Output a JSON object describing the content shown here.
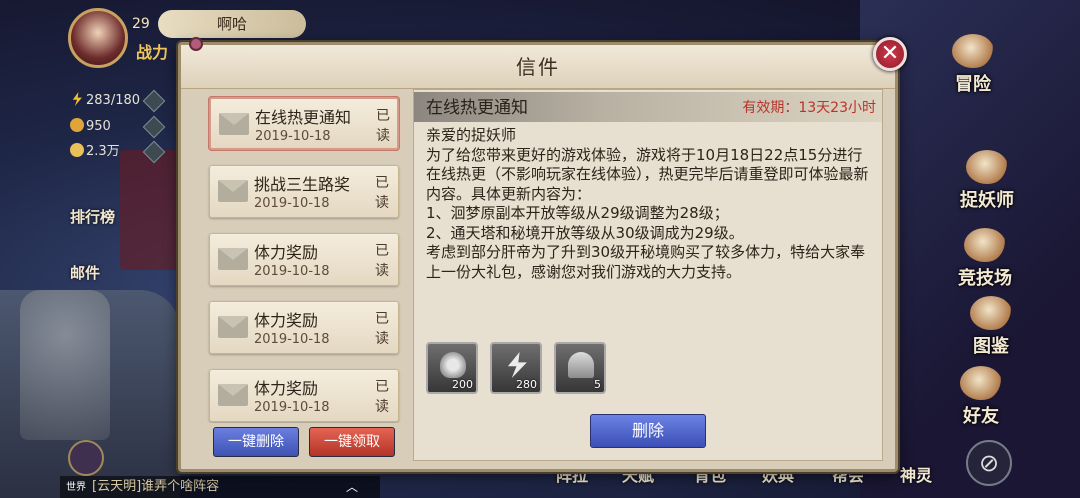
{
  "player": {
    "level": "29",
    "name": "啊哈",
    "power_label": "战力",
    "stamina": "283/180",
    "gold": "950",
    "coins": "2.3万"
  },
  "side_menu": [
    "排行榜",
    "邮件"
  ],
  "right_menu": [
    "冒险",
    "捉妖师",
    "竞技场",
    "图鉴",
    "好友"
  ],
  "bottom_menu": [
    "阵拉",
    "天赋",
    "背包",
    "妖典",
    "帮会",
    "神灵"
  ],
  "chat": {
    "tag": "世界",
    "text": "[云天明]谁弄个啥阵容"
  },
  "dialog": {
    "title": "信件",
    "close_symbol": "✕",
    "mails": [
      {
        "title": "在线热更通知",
        "date": "2019-10-18",
        "status": "已读"
      },
      {
        "title": "挑战三生路奖",
        "date": "2019-10-18",
        "status": "已读"
      },
      {
        "title": "体力奖励",
        "date": "2019-10-18",
        "status": "已读"
      },
      {
        "title": "体力奖励",
        "date": "2019-10-18",
        "status": "已读"
      },
      {
        "title": "体力奖励",
        "date": "2019-10-18",
        "status": "已读"
      }
    ],
    "batch_delete": "一键删除",
    "batch_collect": "一键领取",
    "content": {
      "subject": "在线热更通知",
      "validity": "有效期：13天23小时",
      "body": "亲爱的捉妖师\n为了给您带来更好的游戏体验，游戏将于10月18日22点15分进行在线热更（不影响玩家在线体验），热更完毕后请重登即可体验最新内容。具体更新内容为：\n1、洄梦原副本开放等级从29级调整为28级；\n2、通天塔和秘境开放等级从30级调成为29级。\n考虑到部分肝帝为了升到30级开秘境购买了较多体力，特给大家奉上一份大礼包，感谢您对我们游戏的大力支持。",
      "rewards": [
        {
          "icon": "silver-ingot-icon",
          "count": "200"
        },
        {
          "icon": "stamina-bolt-icon",
          "count": "280"
        },
        {
          "icon": "bell-icon",
          "count": "5"
        }
      ],
      "delete_label": "删除"
    }
  },
  "colors": {
    "accent_red": "#b8342a",
    "button_blue": "#3e52b4",
    "button_red": "#b33327"
  }
}
